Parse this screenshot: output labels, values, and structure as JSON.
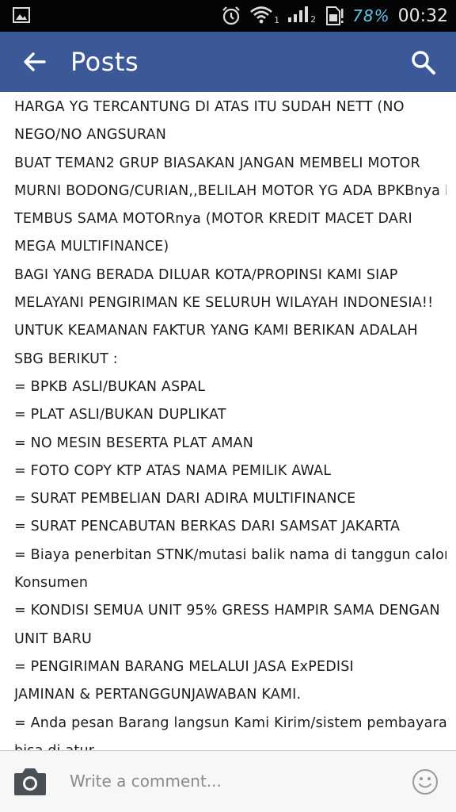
{
  "status_bar": {
    "sim1_label": "1",
    "sim2_label": "2",
    "battery_percent": "78%",
    "time": "00:32"
  },
  "app_bar": {
    "title": "Posts"
  },
  "post": {
    "lines": [
      "HARGA YG TERCANTUNG DI ATAS ITU SUDAH NETT (NO",
      "NEGO/NO ANGSURAN",
      "BUAT TEMAN2 GRUP BIASAKAN JANGAN MEMBELI MOTOR",
      "MURNI BODONG/CURIAN,,BELILAH MOTOR YG ADA BPKBnya DAN",
      "TEMBUS SAMA MOTORnya (MOTOR KREDIT MACET DARI",
      "MEGA MULTIFINANCE)",
      "BAGI YANG BERADA DILUAR KOTA/PROPINSI KAMI SIAP",
      "MELAYANI PENGIRIMAN KE SELURUH WILAYAH INDONESIA!!",
      "UNTUK KEAMANAN FAKTUR YANG KAMI BERIKAN ADALAH",
      "SBG BERIKUT :",
      "= BPKB ASLI/BUKAN ASPAL",
      "= PLAT ASLI/BUKAN DUPLIKAT",
      "= NO MESIN BESERTA PLAT AMAN",
      "= FOTO COPY KTP ATAS NAMA PEMILIK AWAL",
      "= SURAT PEMBELIAN DARI ADIRA MULTIFINANCE",
      "= SURAT PENCABUTAN BERKAS DARI SAMSAT JAKARTA",
      "= Biaya penerbitan STNK/mutasi balik nama di tanggun calong",
      "Konsumen",
      "= KONDISI SEMUA UNIT 95% GRESS HAMPIR SAMA DENGAN",
      "UNIT BARU",
      "= PENGIRIMAN BARANG MELALUI JASA ExPEDISI",
      "JAMINAN & PERTANGGUNJAWABAN KAMI.",
      "= Anda pesan Barang langsun Kami Kirim/sistem pembayaran",
      "bisa di atur"
    ]
  },
  "comment_bar": {
    "placeholder": "Write a comment..."
  },
  "icons": {
    "back": "arrow-left-icon",
    "search": "search-icon",
    "camera": "camera-icon",
    "emoji": "smiley-icon",
    "gallery": "image-icon",
    "alarm": "alarm-icon",
    "wifi": "wifi-icon",
    "signal": "signal-icon",
    "sim": "sim-card-icon"
  },
  "colors": {
    "app_bar": "#3b5998",
    "status_bar": "#050505",
    "battery_text": "#5fc6e8"
  }
}
